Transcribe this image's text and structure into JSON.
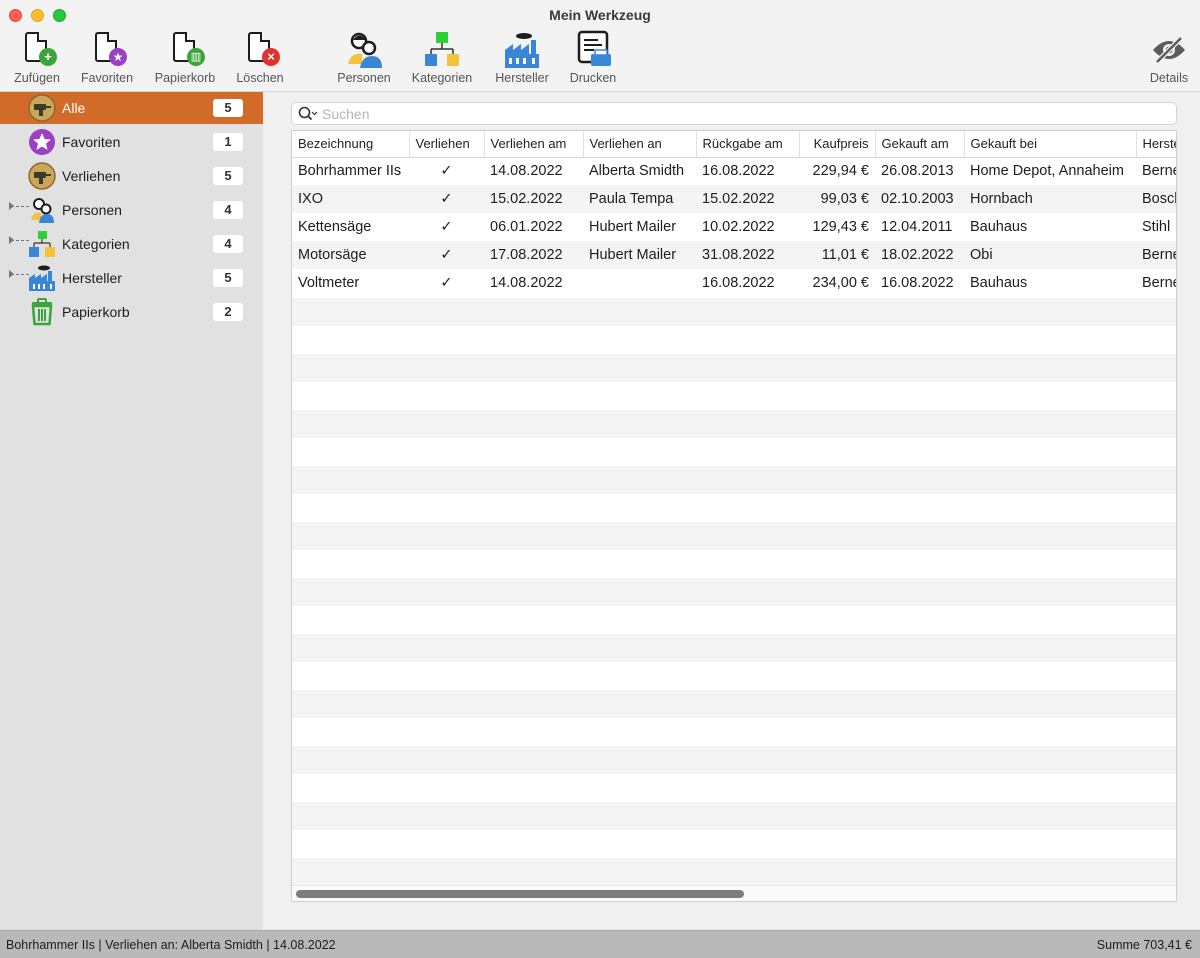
{
  "window": {
    "title": "Mein Werkzeug"
  },
  "toolbar": {
    "add": "Zufügen",
    "favorites": "Favoriten",
    "trash": "Papierkorb",
    "delete": "Löschen",
    "persons": "Personen",
    "categories": "Kategorien",
    "manufacturers": "Hersteller",
    "print": "Drucken",
    "details": "Details"
  },
  "sidebar": {
    "items": [
      {
        "label": "Alle",
        "count": "5",
        "icon": "drill-icon",
        "selected": true
      },
      {
        "label": "Favoriten",
        "count": "1",
        "icon": "star-icon"
      },
      {
        "label": "Verliehen",
        "count": "5",
        "icon": "drill-icon"
      },
      {
        "label": "Personen",
        "count": "4",
        "icon": "persons-icon",
        "expandable": true
      },
      {
        "label": "Kategorien",
        "count": "4",
        "icon": "categories-icon",
        "expandable": true
      },
      {
        "label": "Hersteller",
        "count": "5",
        "icon": "factory-icon",
        "expandable": true
      },
      {
        "label": "Papierkorb",
        "count": "2",
        "icon": "trash-icon"
      }
    ]
  },
  "search": {
    "placeholder": "Suchen",
    "value": ""
  },
  "table": {
    "columns": [
      "Bezeichnung",
      "Verliehen",
      "Verliehen am",
      "Verliehen an",
      "Rückgabe am",
      "Kaufpreis",
      "Gekauft am",
      "Gekauft bei",
      "Herste"
    ],
    "rows": [
      [
        "Bohrhammer IIs",
        "✓",
        "14.08.2022",
        "Alberta Smidth",
        "16.08.2022",
        "229,94 €",
        "26.08.2013",
        "Home Depot, Annaheim",
        "Berne"
      ],
      [
        "IXO",
        "✓",
        "15.02.2022",
        "Paula Tempa",
        "15.02.2022",
        "99,03 €",
        "02.10.2003",
        "Hornbach",
        "Bosch"
      ],
      [
        "Kettensäge",
        "✓",
        "06.01.2022",
        "Hubert Mailer",
        "10.02.2022",
        "129,43 €",
        "12.04.2011",
        "Bauhaus",
        "Stihl"
      ],
      [
        "Motorsäge",
        "✓",
        "17.08.2022",
        "Hubert Mailer",
        "31.08.2022",
        "11,01 €",
        "18.02.2022",
        "Obi",
        "Berne"
      ],
      [
        "Voltmeter",
        "✓",
        "14.08.2022",
        "",
        "16.08.2022",
        "234,00 €",
        "16.08.2022",
        "Bauhaus",
        "Berne"
      ]
    ]
  },
  "status": {
    "left": "Bohrhammer IIs | Verliehen an: Alberta Smidth | 14.08.2022",
    "right": "Summe 703,41 €"
  },
  "colors": {
    "selection": "#d26a2a",
    "sidebar": "#e1e1e1",
    "statusbar": "#b9b9b9"
  }
}
